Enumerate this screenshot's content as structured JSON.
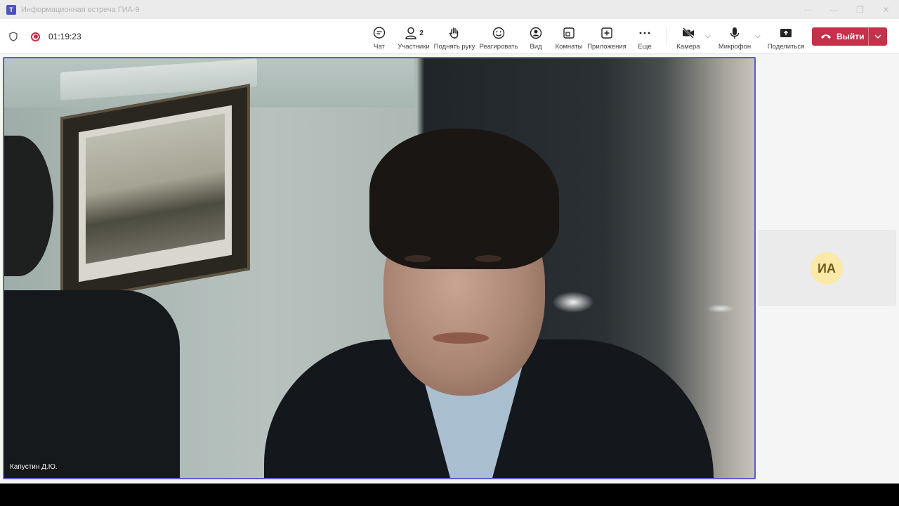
{
  "window": {
    "title": "Информационная встреча ГИА-9",
    "logo_letter": "T"
  },
  "meeting": {
    "timer": "01:19:23"
  },
  "toolbar": {
    "chat": "Чат",
    "participants": "Участники",
    "participants_count": "2",
    "raise_hand": "Поднять руку",
    "react": "Реагировать",
    "view": "Вид",
    "rooms": "Комнаты",
    "apps": "Приложения",
    "more": "Еще",
    "camera": "Камера",
    "microphone": "Микрофон",
    "share": "Поделиться",
    "leave": "Выйти"
  },
  "stage": {
    "speaker_name": "Капустин Д.Ю."
  },
  "participant_tile": {
    "initials": "ИА"
  },
  "colors": {
    "accent": "#5b5fc7",
    "leave": "#c4314b",
    "avatar_bg": "#fbe9a8"
  }
}
